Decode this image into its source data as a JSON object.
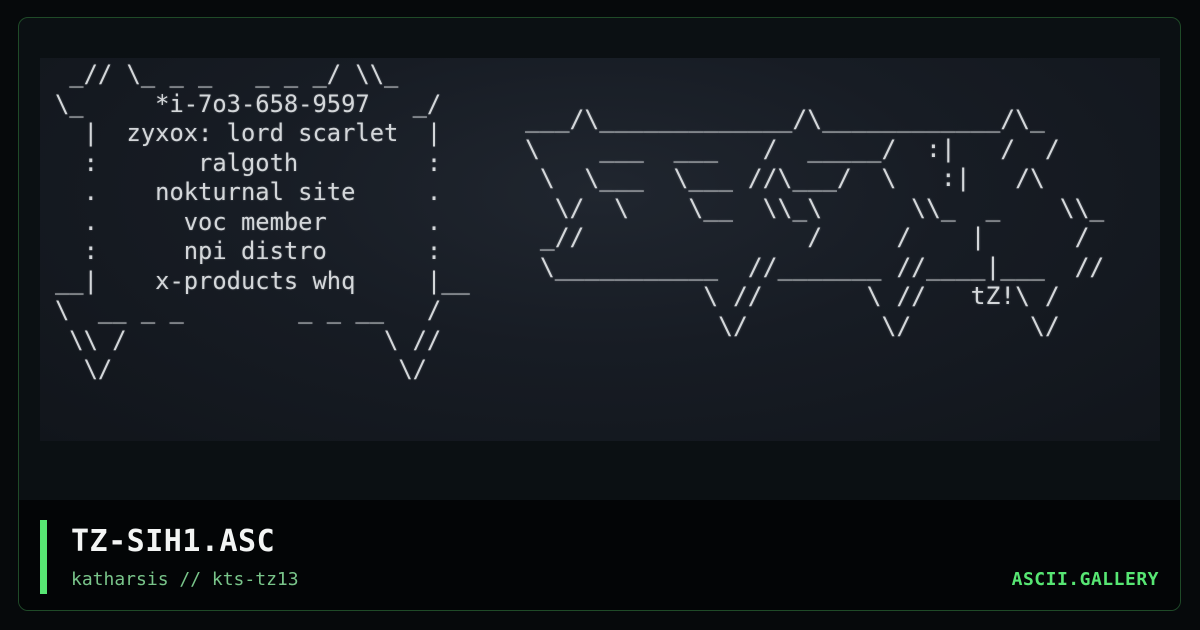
{
  "artwork": {
    "left_panel": " _// \\_ _ _   _ _ _/ \\\\_\n\\_     *i-7o3-658-9597   _/\n  |  zyxox: lord scarlet  |\n  :       ralgoth         :\n  .    nokturnal site     .\n  .      voc member       .\n  :      npi distro       :\n__|    x-products whq     |__\n\\  __ _ _        _ _ __   /\n \\\\ /                  \\ //\n  \\/                    \\/",
    "right_panel": "___/\\_____________/\\____________/\\_\n\\    ___  ___   /  _____/  :|   /  /\n \\  \\___  \\___ //\\___/  \\   :|   /\\\n  \\/  \\    \\__  \\\\_\\      \\\\_  _    \\\\_\n _//               /     /    |      /\n \\___________  //_______ //____|___  //\n            \\ //       \\ //   tZ!\\ /\n             \\/         \\/        \\/"
  },
  "footer": {
    "title": "TZ-SIH1.ASC",
    "subtitle": "katharsis // kts-tz13",
    "brand": "ASCII.GALLERY"
  },
  "colors": {
    "accent": "#57e673",
    "subtitle": "#79c58a",
    "title": "#f3f5f4",
    "frame_border": "#1f4a28"
  }
}
